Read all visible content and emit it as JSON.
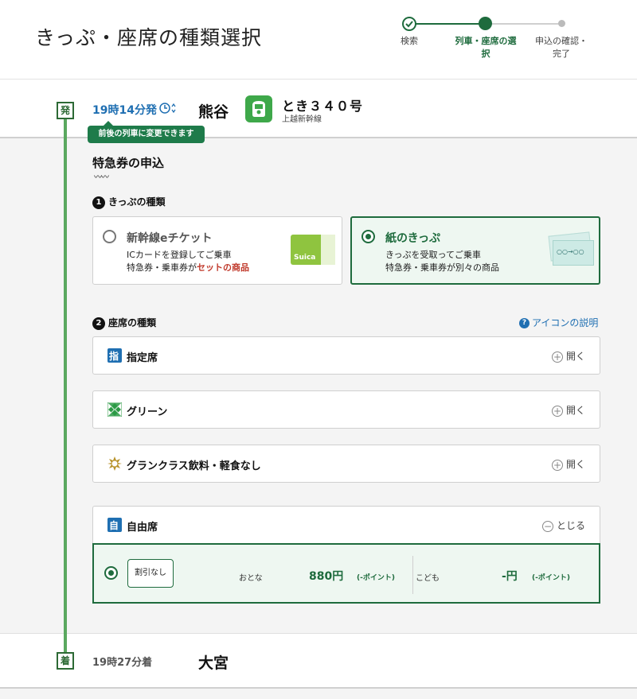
{
  "header": {
    "title": "きっぷ・座席の種類選択",
    "steps": [
      {
        "label": "検索",
        "state": "done"
      },
      {
        "label": "列車・座席の選択",
        "state": "current"
      },
      {
        "label": "申込の確認・完了",
        "state": "pending"
      }
    ]
  },
  "departure": {
    "badge": "発",
    "time": "19時14分発",
    "station": "熊谷",
    "change_tip": "前後の列車に変更できます",
    "train_name": "とき３４０号",
    "train_line": "上越新幹線"
  },
  "arrival": {
    "badge": "着",
    "time": "19時27分着",
    "station": "大宮"
  },
  "section": {
    "title": "特急券の申込",
    "ticket_type": {
      "number": "1",
      "title": "きっぷの種類",
      "options": [
        {
          "title": "新幹線eチケット",
          "desc1": "ICカードを登録してご乗車",
          "desc2_pre": "特急券・乗車券が",
          "desc2_red": "セットの商品",
          "selected": false
        },
        {
          "title": "紙のきっぷ",
          "desc1": "きっぷを受取ってご乗車",
          "desc2_pre": "特急券・乗車券が別々の商品",
          "desc2_red": "",
          "selected": true
        }
      ],
      "suica_label": "Suica",
      "paper_ticket_text": "○○→○○"
    },
    "seat_type": {
      "number": "2",
      "title": "座席の種類",
      "help_link": "アイコンの説明",
      "rows": [
        {
          "label": "指定席",
          "icon": "reserved-seat-icon",
          "icon_char": "指",
          "toggle": "開く",
          "toggle_icon": "+"
        },
        {
          "label": "グリーン",
          "icon": "green-car-icon",
          "icon_char": "",
          "toggle": "開く",
          "toggle_icon": "+"
        },
        {
          "label": "グランクラス飲料・軽食なし",
          "icon": "gran-class-icon",
          "icon_char": "",
          "toggle": "開く",
          "toggle_icon": "+"
        },
        {
          "label": "自由席",
          "icon": "non-reserved-seat-icon",
          "icon_char": "自",
          "toggle": "とじる",
          "toggle_icon": "−"
        }
      ],
      "fare": {
        "discount": "割引なし",
        "adult_label": "おとな",
        "adult_price": "880円",
        "adult_points": "(-ポイント)",
        "child_label": "こども",
        "child_price": "-円",
        "child_points": "(-ポイント)"
      }
    }
  },
  "colors": {
    "accent_green": "#1e6b3d",
    "link_blue": "#1f6fb2",
    "timeline_green": "#5aa85f"
  }
}
